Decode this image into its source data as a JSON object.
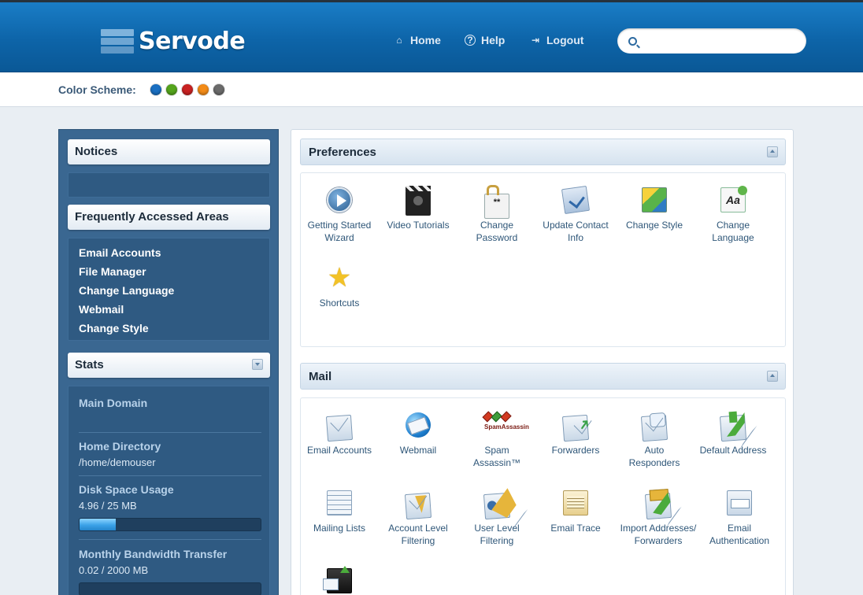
{
  "brand": {
    "name": "Servode"
  },
  "topnav": {
    "home": "Home",
    "help": "Help",
    "logout": "Logout"
  },
  "search": {
    "placeholder": "",
    "value": ""
  },
  "color_scheme": {
    "label": "Color Scheme:",
    "swatches": [
      "#1a6fc2",
      "#55a51c",
      "#c92222",
      "#f38b17",
      "#6b6b6b"
    ]
  },
  "sidebar": {
    "notices_title": "Notices",
    "faa_title": "Frequently Accessed Areas",
    "faa_links": [
      "Email Accounts",
      "File Manager",
      "Change Language",
      "Webmail",
      "Change Style"
    ],
    "stats": {
      "title": "Stats",
      "main_domain_label": "Main Domain",
      "main_domain_value": "",
      "home_dir_label": "Home Directory",
      "home_dir_value": "/home/demouser",
      "disk_label": "Disk Space Usage",
      "disk_value": "4.96 / 25 MB",
      "disk_fraction": 0.198,
      "bandwidth_label": "Monthly Bandwidth Transfer",
      "bandwidth_value": "0.02 / 2000 MB",
      "bandwidth_fraction": 1e-05
    }
  },
  "preferences": {
    "title": "Preferences",
    "items": [
      {
        "label": "Getting Started Wizard",
        "icon": "play-icon"
      },
      {
        "label": "Video Tutorials",
        "icon": "clapperboard-icon"
      },
      {
        "label": "Change Password",
        "icon": "password-icon"
      },
      {
        "label": "Update Contact Info",
        "icon": "contact-info-icon"
      },
      {
        "label": "Change Style",
        "icon": "style-icon"
      },
      {
        "label": "Change Language",
        "icon": "language-icon"
      },
      {
        "label": "Shortcuts",
        "icon": "star-icon"
      }
    ]
  },
  "mail": {
    "title": "Mail",
    "items": [
      {
        "label": "Email Accounts",
        "icon": "envelope-icon"
      },
      {
        "label": "Webmail",
        "icon": "webmail-icon"
      },
      {
        "label": "Spam Assassin™",
        "icon": "spamassassin-icon",
        "logo_text": "SpamAssassin"
      },
      {
        "label": "Forwarders",
        "icon": "forwarders-icon"
      },
      {
        "label": "Auto Responders",
        "icon": "auto-responder-icon"
      },
      {
        "label": "Default Address",
        "icon": "default-address-icon"
      },
      {
        "label": "Mailing Lists",
        "icon": "mailing-list-icon"
      },
      {
        "label": "Account Level Filtering",
        "icon": "filter-icon"
      },
      {
        "label": "User Level Filtering",
        "icon": "user-filter-icon"
      },
      {
        "label": "Email Trace",
        "icon": "email-trace-icon"
      },
      {
        "label": "Import Addresses/ Forwarders",
        "icon": "import-icon"
      },
      {
        "label": "Email Authentication",
        "icon": "email-auth-icon"
      },
      {
        "label": "",
        "icon": "mx-entry-icon"
      }
    ]
  }
}
